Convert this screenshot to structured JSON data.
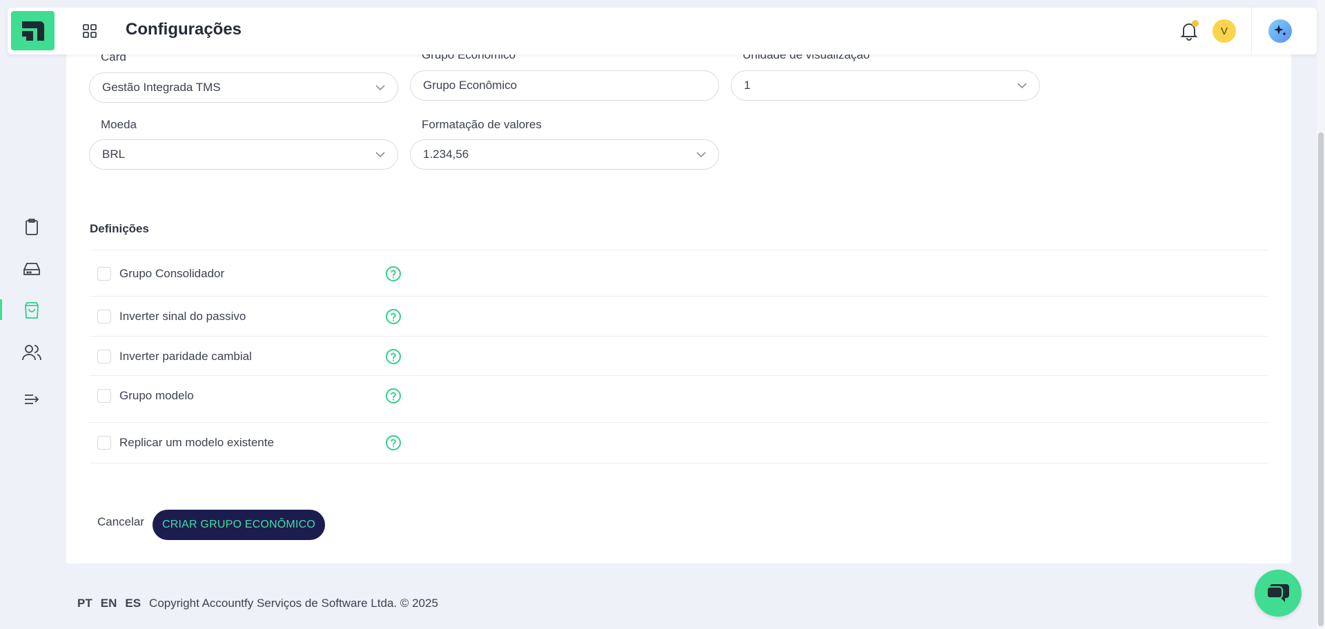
{
  "header": {
    "title": "Configurações",
    "avatar_initial": "V"
  },
  "form": {
    "card_label": "Card",
    "card_value": "Gestão Integrada TMS",
    "group_label": "Grupo Econômico",
    "group_value": "Grupo Econômico",
    "unit_label": "Unidade de visualização",
    "unit_value": "1",
    "currency_label": "Moeda",
    "currency_value": "BRL",
    "format_label": "Formatação de valores",
    "format_value": "1.234,56"
  },
  "definitions": {
    "title": "Definições",
    "items": [
      {
        "label": "Grupo Consolidador",
        "checked": false
      },
      {
        "label": "Inverter sinal do passivo",
        "checked": false
      },
      {
        "label": "Inverter paridade cambial",
        "checked": false
      },
      {
        "label": "Grupo modelo",
        "checked": false
      },
      {
        "label": "Replicar um modelo existente",
        "checked": false
      }
    ]
  },
  "actions": {
    "cancel_label": "Cancelar",
    "create_label": "CRIAR GRUPO ECONÔMICO"
  },
  "footer": {
    "languages": [
      "PT",
      "EN",
      "ES"
    ],
    "copyright": "Copyright Accountfy Serviços de Software Ltda. © 2025"
  },
  "colors": {
    "accent": "#3fdc91",
    "primary_button": "#1d1c4f",
    "primary_button_text": "#3ee0a2",
    "background": "#eff1f8"
  },
  "icons": {
    "sidebar": [
      "clipboard-icon",
      "inbox-icon",
      "shopping-bag-icon",
      "users-icon",
      "collapse-menu-icon"
    ]
  }
}
